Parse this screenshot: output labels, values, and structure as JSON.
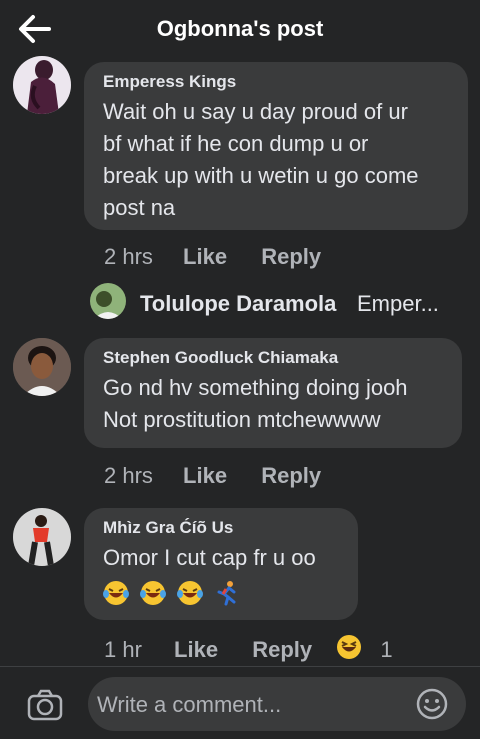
{
  "header": {
    "title": "Ogbonna's post"
  },
  "comments": [
    {
      "author": "Emperess Kings",
      "lines": [
        "Wait oh u say u day proud of ur",
        "bf what if he con dump u or",
        "break up with u wetin u go come",
        "post na"
      ],
      "time": "2 hrs",
      "like": "Like",
      "reply": "Reply"
    },
    {
      "author": "Stephen Goodluck Chiamaka",
      "lines": [
        "Go nd hv something doing jooh",
        "Not prostitution mtchewwww"
      ],
      "time": "2 hrs",
      "like": "Like",
      "reply": "Reply"
    },
    {
      "author": "Mhìz Gra Ćíõ Us",
      "lines": [
        "Omor I cut cap fr u oo"
      ],
      "time": "1 hr",
      "like": "Like",
      "reply": "Reply",
      "reaction_count": "1"
    }
  ],
  "reply_preview": {
    "author": "Tolulope Daramola",
    "snippet": "Emper..."
  },
  "composer": {
    "placeholder": "Write a comment..."
  }
}
